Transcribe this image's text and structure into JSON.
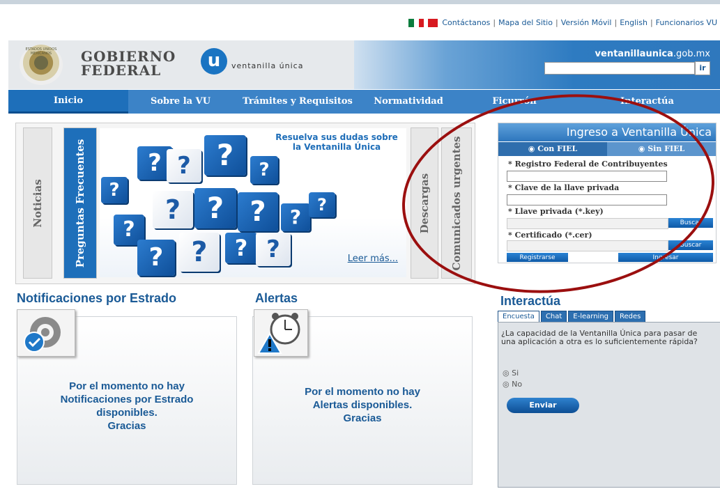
{
  "top_links": [
    "Contáctanos",
    "Mapa del Sitio",
    "Versión Móvil",
    "English",
    "Funcionarios VU"
  ],
  "colors": {
    "primary": "#1a5a96",
    "nav": "#3c83c7",
    "annotation": "#9b0f0f"
  },
  "header": {
    "seal_text": "ESTADOS UNIDOS MEXICANOS",
    "gobierno_1": "Gobierno",
    "gobierno_2": "Federal",
    "vu_letter": "u",
    "vu_name": "ventanilla única",
    "domain_bold": "ventanillaunica",
    "domain_rest": ".gob.mx",
    "search_button": "ir"
  },
  "nav": [
    "Inicio",
    "Sobre la VU",
    "Trámites y Requisitos",
    "Normatividad",
    "Ficurrón",
    "Interactúa"
  ],
  "carousel": {
    "tabs": [
      "Noticias",
      "Preguntas Frecuentes",
      "Descargas",
      "Comunicados urgentes"
    ],
    "caption": "Resuelva sus dudas sobre la Ventanilla Única",
    "read_more": "Leer más...",
    "cube_glyph": "?"
  },
  "login": {
    "title": "Ingreso a Ventanilla Única",
    "tab_con": "Con FIEL",
    "tab_sin": "Sin FIEL",
    "radio_on": "◉",
    "radio_off": "◉",
    "rfc_label": "* Registro Federal de Contribuyentes",
    "clave_label": "* Clave de la llave privada",
    "llave_label": "* Llave privada (*.key)",
    "cert_label": "* Certificado (*.cer)",
    "buscar": "Buscar",
    "registrarse": "Registrarse",
    "ingresar": "Ingresar"
  },
  "notificaciones": {
    "title": "Notificaciones por Estrado",
    "message_lines": [
      "Por el momento no hay",
      "Notificaciones por Estrado",
      "disponibles.",
      "Gracias"
    ]
  },
  "alertas": {
    "title": "Alertas",
    "message_lines": [
      "Por el momento no hay",
      "Alertas disponibles.",
      "Gracias"
    ]
  },
  "interactua": {
    "title": "Interactúa",
    "tabs": [
      "Encuesta",
      "Chat",
      "E-learning",
      "Redes"
    ],
    "question": "¿La capacidad de la Ventanilla Única para pasar de una aplicación a otra es lo suficientemente rápida?",
    "radio_symbol": "◎",
    "options": [
      "Si",
      "No"
    ],
    "submit": "Enviar"
  }
}
